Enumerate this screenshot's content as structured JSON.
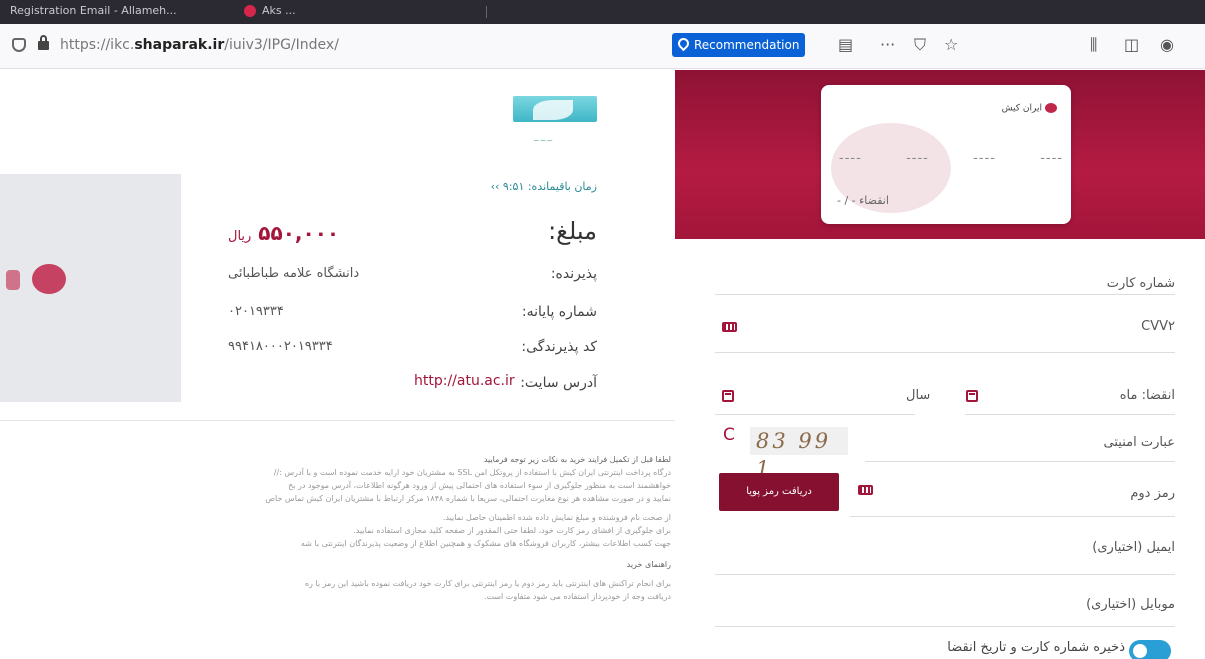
{
  "browser": {
    "tab_title": "Registration Email - Allameh...",
    "tab2_title": "Aks ...",
    "url_prefix": "https://ikc.",
    "url_domain": "shaparak.ir",
    "url_path": "/iuiv3/IPG/Index/",
    "recommendation_label": "Recommendation",
    "more_label": "···"
  },
  "merchant": {
    "timer": "زمان باقیمانده: ۹:۵۱ ››",
    "amount_label": "مبلغ:",
    "amount_value": "۵۵۰,۰۰۰",
    "amount_currency": "ریال",
    "payee_label": "پذیرنده:",
    "payee_value": "دانشگاه علامه طباطبائی",
    "terminal_label": "شماره پایانه:",
    "terminal_value": "۰۲۰۱۹۳۳۴",
    "merchant_code_label": "کد پذیرندگی:",
    "merchant_code_value": "۹۹۴۱۸۰۰۰۲۰۱۹۳۳۴",
    "site_label": "آدرس سایت:",
    "site_value": "http://atu.ac.ir"
  },
  "rules": {
    "heading": "لطفا قبل از تکمیل فرایند خرید به نکات زیر توجه فرمایید",
    "p1": "درگاه پرداخت اینترنتی ایران کیش با استفاده از پروتکل امن SSL به مشتریان خود ارایه خدمت نموده است و با آدرس ://",
    "p2": "خواهشمند است به منظور جلوگیری از سوء استفاده های احتمالی پیش از ورود هرگونه اطلاعات، آدرس موجود در بخ",
    "p3": "نمایید و در صورت مشاهده هر نوع مغایرت احتمالی، سریعا با شماره ۱۸۴۸ مرکز ارتباط با مشتریان ایران کیش تماس حاص",
    "b1": "از صحت نام فروشنده و مبلغ نمایش داده شده اطمینان حاصل نمایید.",
    "b2": "برای جلوگیری از افشای رمز کارت خود، لطفا حتی المقدور از صفحه کلید مجازی استفاده نمایید.",
    "b3": "جهت کسب اطلاعات بیشتر، کاربران فروشگاه های مشکوک و همچنین اطلاع از وضعیت پذیرندگان اینترنتی با شه",
    "guide_heading": "راهنمای خرید",
    "g1": "برای انجام تراکنش های اینترنتی باید رمز دوم یا رمز اینترنتی برای کارت خود دریافت نموده باشید این رمز با ره",
    "g2": "دریافت وجه از خودپرداز استفاده می شود متفاوت است."
  },
  "card": {
    "brand": "ایران کیش",
    "d1": "----",
    "d2": "----",
    "d3": "----",
    "d4": "----",
    "expiry": "انقضاء - / -"
  },
  "form": {
    "card_number_label": "شماره کارت",
    "cvv2_label": "CVV۲",
    "expiry_month_label": "انقضا: ماه",
    "expiry_year_label": "سال",
    "captcha_label": "عبارت امنیتی",
    "captcha_value": "83 99 1",
    "refresh_icon": "C",
    "second_pin_label": "رمز دوم",
    "otp_button": "دریافت رمز پویا",
    "email_label": "ایمیل (اختیاری)",
    "mobile_label": "موبایل (اختیاری)",
    "save_card_label": "ذخیره شماره کارت و تاریخ انقضا"
  },
  "colors": {
    "brand": "#a3153a",
    "accent": "#0b62d6",
    "toggle": "#2a9fd6"
  }
}
